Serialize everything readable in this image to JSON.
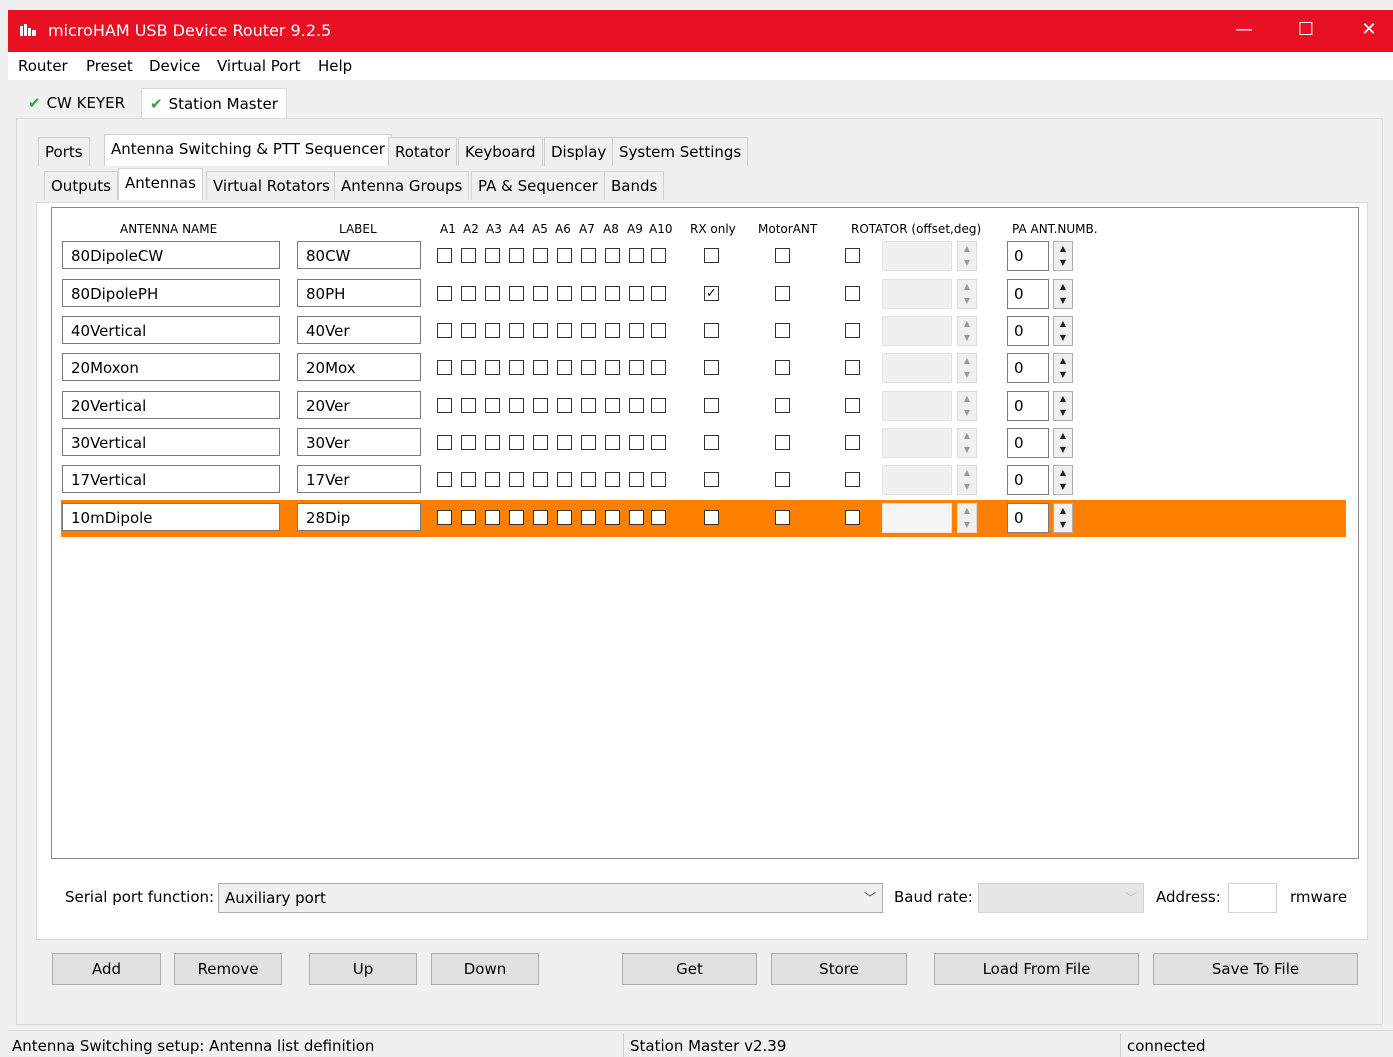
{
  "window": {
    "title": "microHAM USB Device Router 9.2.5",
    "titlebar_color": "#e81123",
    "controls": [
      "minimize-icon",
      "maximize-icon",
      "close-icon"
    ]
  },
  "menu": [
    "Router",
    "Preset",
    "Device",
    "Virtual Port",
    "Help"
  ],
  "device_tabs": [
    {
      "label": "CW KEYER",
      "icon": "green-check-icon"
    },
    {
      "label": "Station Master",
      "icon": "green-check-icon",
      "active": true
    }
  ],
  "main_tabs": [
    "Ports",
    "Antenna Switching & PTT Sequencer",
    "Rotator",
    "Keyboard",
    "Display",
    "System Settings"
  ],
  "sub_tabs": [
    "Outputs",
    "Antennas",
    "Virtual Rotators",
    "Antenna Groups",
    "PA & Sequencer",
    "Bands"
  ],
  "columns": {
    "antenna_name": "ANTENNA NAME",
    "label": "LABEL",
    "a_outputs": [
      "A1",
      "A2",
      "A3",
      "A4",
      "A5",
      "A6",
      "A7",
      "A8",
      "A9",
      "A10"
    ],
    "rx_only": "RX only",
    "motor_ant": "MotorANT",
    "rotator": "ROTATOR (offset,deg)",
    "pa_ant_numb": "PA ANT.NUMB."
  },
  "antennas": [
    {
      "name": "80DipoleCW",
      "label": "80CW",
      "rx_only": false,
      "pa": "0"
    },
    {
      "name": "80DipolePH",
      "label": "80PH",
      "rx_only": true,
      "pa": "0"
    },
    {
      "name": "40Vertical",
      "label": "40Ver",
      "rx_only": false,
      "pa": "0"
    },
    {
      "name": "20Moxon",
      "label": "20Mox",
      "rx_only": false,
      "pa": "0"
    },
    {
      "name": "20Vertical",
      "label": "20Ver",
      "rx_only": false,
      "pa": "0"
    },
    {
      "name": "30Vertical",
      "label": "30Ver",
      "rx_only": false,
      "pa": "0"
    },
    {
      "name": "17Vertical",
      "label": "17Ver",
      "rx_only": false,
      "pa": "0"
    },
    {
      "name": "10mDipole",
      "label": "28Dip",
      "rx_only": false,
      "pa": "0",
      "selected": true
    }
  ],
  "selected_color": "#ff7f00",
  "serial": {
    "function_label": "Serial port function:",
    "function_value": "Auxiliary port",
    "baud_label": "Baud rate:",
    "address_label": "Address:",
    "firmware_label": "rmware"
  },
  "buttons": [
    "Add",
    "Remove",
    "Up",
    "Down",
    "Get",
    "Store",
    "Load From File",
    "Save To File"
  ],
  "status": {
    "left": "Antenna Switching setup: Antenna list definition",
    "middle": "Station Master v2.39",
    "right": "connected"
  }
}
